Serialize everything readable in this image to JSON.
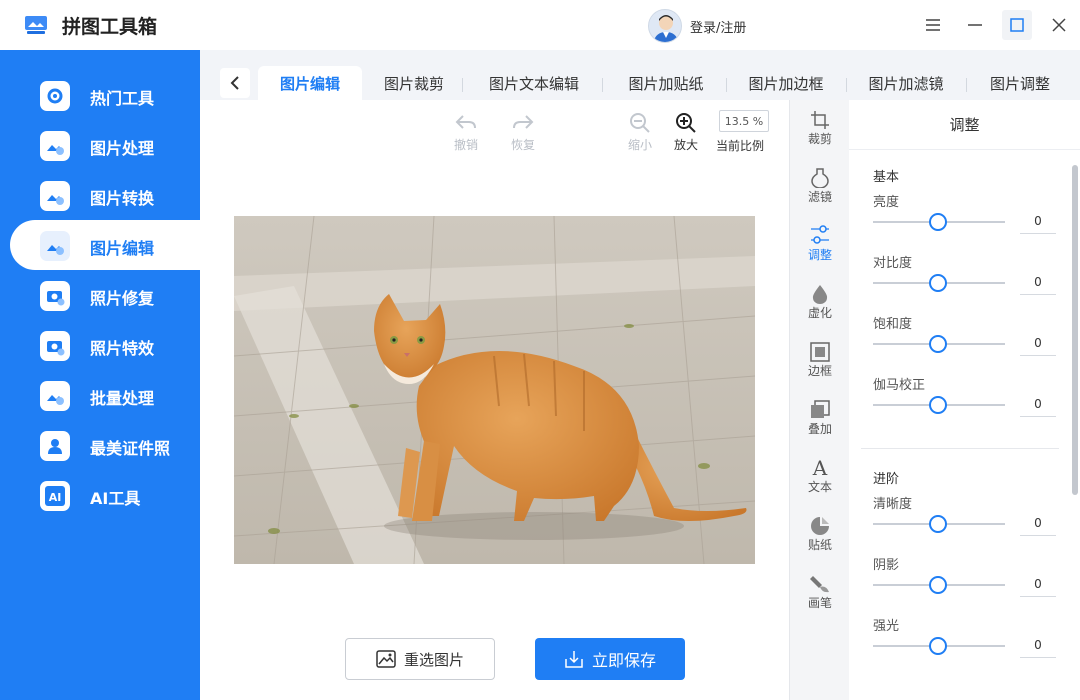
{
  "app": {
    "title": "拼图工具箱",
    "login_label": "登录/注册"
  },
  "window_controls": [
    "menu-icon",
    "minimize-icon",
    "maximize-icon",
    "close-icon"
  ],
  "sidebar": {
    "items": [
      {
        "label": "热门工具",
        "icon": "gear-icon"
      },
      {
        "label": "图片处理",
        "icon": "image-clock-icon"
      },
      {
        "label": "图片转换",
        "icon": "image-convert-icon"
      },
      {
        "label": "图片编辑",
        "icon": "image-edit-icon",
        "active": true
      },
      {
        "label": "照片修复",
        "icon": "camera-plus-icon"
      },
      {
        "label": "照片特效",
        "icon": "camera-magic-icon"
      },
      {
        "label": "批量处理",
        "icon": "image-batch-icon"
      },
      {
        "label": "最美证件照",
        "icon": "id-photo-icon"
      },
      {
        "label": "AI工具",
        "icon": "ai-icon"
      }
    ]
  },
  "tabs": [
    "图片编辑",
    "图片裁剪",
    "图片文本编辑",
    "图片加贴纸",
    "图片加边框",
    "图片加滤镜",
    "图片调整"
  ],
  "toolbar": {
    "undo": "撤销",
    "redo": "恢复",
    "zoom_out": "缩小",
    "zoom_in": "放大",
    "zoom_value": "13.5 %",
    "zoom_caption": "当前比例"
  },
  "actions": {
    "reselect": "重选图片",
    "save": "立即保存"
  },
  "vtools": [
    {
      "label": "裁剪",
      "icon": "crop-icon"
    },
    {
      "label": "滤镜",
      "icon": "filter-icon"
    },
    {
      "label": "调整",
      "icon": "adjust-icon",
      "active": true
    },
    {
      "label": "虚化",
      "icon": "blur-icon"
    },
    {
      "label": "边框",
      "icon": "border-icon"
    },
    {
      "label": "叠加",
      "icon": "overlay-icon"
    },
    {
      "label": "文本",
      "icon": "text-icon"
    },
    {
      "label": "贴纸",
      "icon": "sticker-icon"
    },
    {
      "label": "画笔",
      "icon": "brush-icon"
    }
  ],
  "panel": {
    "title": "调整",
    "basic": {
      "title": "基本",
      "sliders": [
        {
          "label": "亮度",
          "value": "0"
        },
        {
          "label": "对比度",
          "value": "0"
        },
        {
          "label": "饱和度",
          "value": "0"
        },
        {
          "label": "伽马校正",
          "value": "0"
        }
      ]
    },
    "advanced": {
      "title": "进阶",
      "sliders": [
        {
          "label": "清晰度",
          "value": "0"
        },
        {
          "label": "阴影",
          "value": "0"
        },
        {
          "label": "强光",
          "value": "0"
        }
      ]
    }
  },
  "colors": {
    "accent": "#1f7ef4",
    "sidebar_bg": "#1f7ef4"
  }
}
